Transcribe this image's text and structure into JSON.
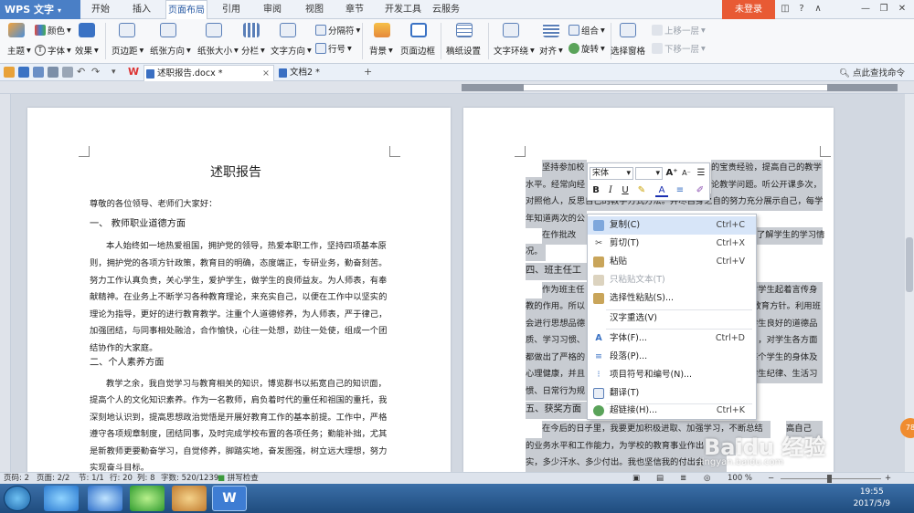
{
  "app": {
    "logo": "WPS 文字",
    "login": "未登录"
  },
  "menu_tabs": [
    "开始",
    "插入",
    "页面布局",
    "引用",
    "审阅",
    "视图",
    "章节",
    "开发工具",
    "云服务"
  ],
  "ribbon": {
    "theme": "主题",
    "colors": "颜色",
    "fonts": "字体",
    "effects": "效果",
    "margins": "页边距",
    "orientation": "纸张方向",
    "size": "纸张大小",
    "columns": "分栏",
    "text_direction": "文字方向",
    "separator": "分隔符",
    "line_numbers": "行号",
    "background": "背景",
    "page_border": "页面边框",
    "manuscript": "稿纸设置",
    "wrap": "文字环绕",
    "align": "对齐",
    "rotate": "旋转",
    "group": "组合",
    "selection_pane": "选择窗格",
    "bring_forward": "上移一层",
    "send_backward": "下移一层"
  },
  "doc_tabs": [
    {
      "label": "述职报告.docx *"
    },
    {
      "label": "文档2 *"
    }
  ],
  "find_command": "点此查找命令",
  "page1": {
    "title": "述职报告",
    "lines": [
      "尊敬的各位领导、老师们大家好：",
      "一、  教师职业道德方面",
      "本人始终如一地热爱祖国，拥护党的领导，热爱本职工作，坚持四项基本原",
      "则，拥护党的各项方针政策，教育目的明确，态度端正，专研业务，勤奋刻苦。",
      "努力工作认真负责，关心学生，爱护学生，做学生的良师益友。为人师表，有奉",
      "献精神。在业务上不断学习各种教育理论，来充实自己，以便在工作中以坚实的",
      "理论为指导，更好的进行教育教学。注重个人道德修养，为人师表，严于律己，",
      "加强团结，与同事相处融洽，合作愉快，心往一处想，劲往一处使，组成一个团",
      "结协作的大家庭。",
      "二、个人素养方面",
      "教学之余，我自觉学习与教育相关的知识，博览群书以拓宽自己的知识面，",
      "提高个人的文化知识素养。作为一名教师，肩负着时代的重任和祖国的重托，我",
      "深刻地认识到，提高思想政治觉悟是开展好教育工作的基本前提。工作中，严格",
      "遵守各项规章制度，团结同事，及时完成学校布置的各项任务；勤能补拙，尤其",
      "是新教师更要勤奋学习，自觉修养，脚踏实地，奋发图强，树立远大理想，努力",
      "实现奋斗目标。"
    ]
  },
  "page2": {
    "lines": [
      "坚持参加校",
      "的宝贵经验，提高自己的教学",
      "水平。经常向经",
      "论教学问题。听公开课多次，",
      "对照他人，反思自己的教学方式方法。并尽自身之自的努力充分展示自己，每学",
      "年知道两次的公",
      "在作批改",
      "了解学生的学习情",
      "况。",
      "四、班主任工",
      "作为班主任",
      "对学生起着言传身",
      "教的作用。所以",
      "学生为本的教育方针。利用班",
      "会进行思想品德",
      "学生良好的道德品",
      "质、学习习惯、",
      "月，对学生各方面",
      "都做出了严格的",
      "每个学生的身体及",
      "心理健康，并且",
      "学生纪律、生活习",
      "惯、日常行为规",
      "五、获奖方面",
      "在今后的日子里，我要更加积极进取、加强学习，不断总结",
      "高自己",
      "的业务水平和工作能力，为学校的教育事业作出",
      "实，多少汗水、多少付出。我也坚信我的付出会"
    ]
  },
  "mini_toolbar": {
    "font": "宋体",
    "size": "",
    "bold": "B",
    "italic": "I",
    "underline": "U"
  },
  "context_menu": [
    {
      "label": "复制(C)",
      "shortcut": "Ctrl+C",
      "icon": "copy-icon",
      "disabled": false,
      "hover": true
    },
    {
      "label": "剪切(T)",
      "shortcut": "Ctrl+X",
      "icon": "scissors-icon",
      "disabled": false,
      "hover": false
    },
    {
      "label": "粘贴",
      "shortcut": "Ctrl+V",
      "icon": "paste-icon",
      "disabled": false,
      "hover": false
    },
    {
      "label": "只粘贴文本(T)",
      "shortcut": "",
      "icon": "paste-text-icon",
      "disabled": true,
      "hover": false
    },
    {
      "label": "选择性粘贴(S)...",
      "shortcut": "",
      "icon": "paste-special-icon",
      "disabled": false,
      "hover": false
    },
    {
      "label": "汉字重选(V)",
      "shortcut": "",
      "icon": "",
      "disabled": false,
      "hover": false
    },
    {
      "label": "字体(F)...",
      "shortcut": "Ctrl+D",
      "icon": "font-icon",
      "disabled": false,
      "hover": false
    },
    {
      "label": "段落(P)...",
      "shortcut": "",
      "icon": "paragraph-icon",
      "disabled": false,
      "hover": false
    },
    {
      "label": "项目符号和编号(N)...",
      "shortcut": "",
      "icon": "bullets-icon",
      "disabled": false,
      "hover": false
    },
    {
      "label": "翻译(T)",
      "shortcut": "",
      "icon": "translate-icon",
      "disabled": false,
      "hover": false
    },
    {
      "label": "超链接(H)...",
      "shortcut": "Ctrl+K",
      "icon": "hyperlink-icon",
      "disabled": false,
      "hover": false
    }
  ],
  "status": {
    "page": "页码: 2",
    "pages": "页面: 2/2",
    "section": "节: 1/1",
    "row": "行: 20",
    "col": "列: 8",
    "words": "字数: 520/1239",
    "spell": "拼写检查",
    "zoom": "100 %"
  },
  "taskbar": {
    "time": "19:55",
    "date": "2017/5/9"
  },
  "badge": "78",
  "watermark": {
    "brand": "Baidu 经验",
    "url": "jingyan.baidu.com"
  },
  "colors": {
    "accent": "#2c5da6",
    "login": "#e85a34",
    "logo": "#4a7fc6",
    "highlight": "#c8ccd2"
  }
}
